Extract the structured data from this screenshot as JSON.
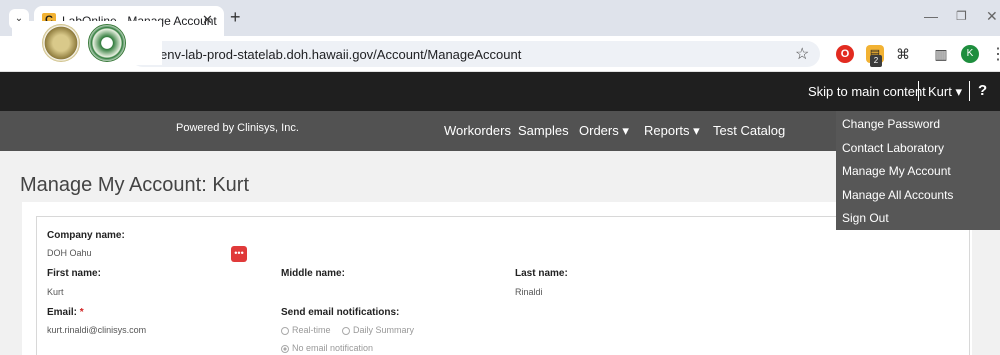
{
  "browser": {
    "tab_title": "LabOnline - Manage Account",
    "favicon_letter": "C",
    "url": "env-lab-prod-statelab.doh.hawaii.gov/Account/ManageAccount",
    "ext_badge": "2",
    "profile_initial": "K"
  },
  "header": {
    "skip_link": "Skip to main content",
    "user_label": "Kurt",
    "help": "?",
    "powered_by": "Powered by Clinisys, Inc."
  },
  "nav": {
    "workorders": "Workorders",
    "samples": "Samples",
    "orders": "Orders",
    "reports": "Reports",
    "test_catalog": "Test Catalog"
  },
  "user_menu": [
    "Change Password",
    "Contact Laboratory",
    "Manage My Account",
    "Manage All Accounts",
    "Sign Out"
  ],
  "page": {
    "title": "Manage My Account: Kurt"
  },
  "form": {
    "company_label": "Company name:",
    "company_value": "DOH Oahu",
    "first_label": "First name:",
    "first_value": "Kurt",
    "middle_label": "Middle name:",
    "last_label": "Last name:",
    "last_value": "Rinaldi",
    "email_label": "Email:",
    "email_value": "kurt.rinaldi@clinisys.com",
    "notify_label": "Send email notifications:",
    "notify_options": [
      "Real-time",
      "Daily Summary",
      "No email notification"
    ]
  }
}
